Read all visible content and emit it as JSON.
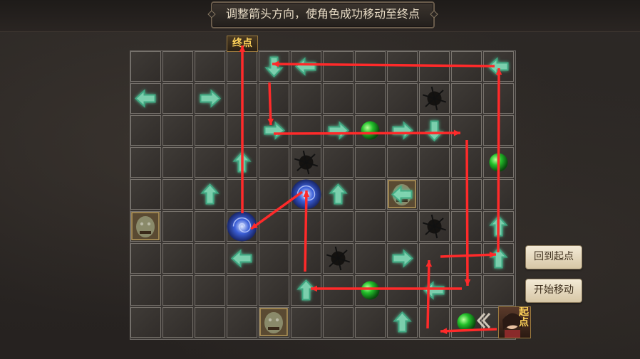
{
  "header": {
    "instruction": "调整箭头方向，使角色成功移动至终点"
  },
  "board": {
    "cols": 9,
    "rows": 9,
    "finish_label": "终点",
    "start_label": "起点",
    "arrows": [
      {
        "col": 4,
        "row": 0,
        "dir": "down"
      },
      {
        "col": 5,
        "row": 0,
        "dir": "left"
      },
      {
        "col": 11,
        "row": 0,
        "dir": "left"
      },
      {
        "col": 0,
        "row": 1,
        "dir": "left"
      },
      {
        "col": 2,
        "row": 1,
        "dir": "right"
      },
      {
        "col": 4,
        "row": 2,
        "dir": "right"
      },
      {
        "col": 6,
        "row": 2,
        "dir": "right"
      },
      {
        "col": 8,
        "row": 2,
        "dir": "right"
      },
      {
        "col": 9,
        "row": 2,
        "dir": "down"
      },
      {
        "col": 3,
        "row": 3,
        "dir": "up"
      },
      {
        "col": 2,
        "row": 4,
        "dir": "up"
      },
      {
        "col": 6,
        "row": 4,
        "dir": "up"
      },
      {
        "col": 8,
        "row": 4,
        "dir": "left"
      },
      {
        "col": 11,
        "row": 5,
        "dir": "up"
      },
      {
        "col": 3,
        "row": 6,
        "dir": "left"
      },
      {
        "col": 8,
        "row": 6,
        "dir": "right"
      },
      {
        "col": 11,
        "row": 6,
        "dir": "up"
      },
      {
        "col": 5,
        "row": 7,
        "dir": "up"
      },
      {
        "col": 9,
        "row": 7,
        "dir": "left"
      },
      {
        "col": 8,
        "row": 8,
        "dir": "up"
      }
    ],
    "green_orbs": [
      {
        "col": 7,
        "row": 2
      },
      {
        "col": 11,
        "row": 3
      },
      {
        "col": 7,
        "row": 7
      },
      {
        "col": 10,
        "row": 8
      }
    ],
    "holes": [
      {
        "col": 9,
        "row": 1
      },
      {
        "col": 5,
        "row": 3
      },
      {
        "col": 9,
        "row": 5
      },
      {
        "col": 6,
        "row": 6
      }
    ],
    "portals": [
      {
        "col": 5,
        "row": 4
      },
      {
        "col": 3,
        "row": 5
      }
    ],
    "monsters": [
      {
        "col": 8,
        "row": 4
      },
      {
        "col": 0,
        "row": 5
      },
      {
        "col": 4,
        "row": 8
      }
    ]
  },
  "buttons": {
    "reset": "回到起点",
    "start": "开始移动"
  },
  "colors": {
    "arrow_fill": "#7fd8b4",
    "arrow_glow": "#3fae86",
    "path_red": "#ff2a2a",
    "orb_green": "#22c02a",
    "portal_blue": "#3b5fd8"
  }
}
